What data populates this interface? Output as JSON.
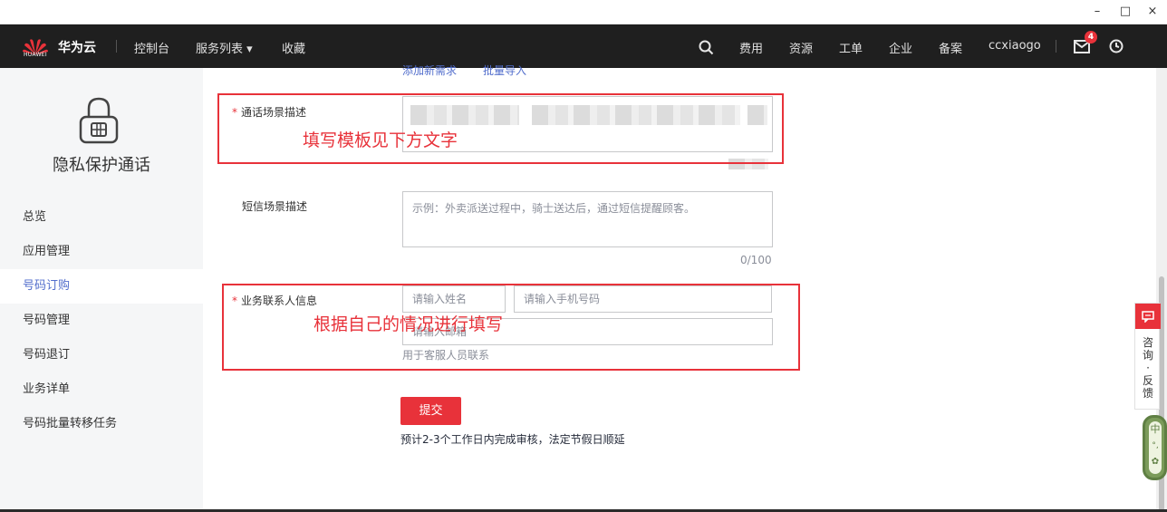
{
  "titlebar": {
    "minimize": "–",
    "maximize": "□",
    "close": "×"
  },
  "topnav": {
    "logo_text": "HUAWEI",
    "brand": "华为云",
    "console": "控制台",
    "services": "服务列表 ▾",
    "favorites": "收藏",
    "cost": "费用",
    "resources": "资源",
    "ticket": "工单",
    "enterprise": "企业",
    "filing": "备案",
    "username": "ccxiaogo",
    "message_count": "4"
  },
  "sidebar": {
    "title": "隐私保护通话",
    "items": [
      {
        "label": "总览"
      },
      {
        "label": "应用管理"
      },
      {
        "label": "号码订购",
        "active": true
      },
      {
        "label": "号码管理"
      },
      {
        "label": "号码退订"
      },
      {
        "label": "业务详单"
      },
      {
        "label": "号码批量转移任务"
      }
    ]
  },
  "form": {
    "add_new_link": "添加新需求",
    "batch_import_link": "批量导入",
    "call_scene": {
      "required": "*",
      "label": "通话场景描述"
    },
    "sms_scene": {
      "label": "短信场景描述",
      "placeholder": "示例：外卖派送过程中，骑士送达后，通过短信提醒顾客。",
      "counter": "0/100"
    },
    "contact": {
      "required": "*",
      "label": "业务联系人信息",
      "name_placeholder": "请输入姓名",
      "phone_placeholder": "请输入手机号码",
      "email_placeholder": "请输入邮箱",
      "hint": "用于客服人员联系"
    },
    "submit": "提交",
    "note": "预计2-3个工作日内完成审核，法定节假日顺延"
  },
  "annotations": {
    "call_scene_note": "填写模板见下方文字",
    "contact_note": "根据自己的情况进行填写"
  },
  "feedback": {
    "label_1": "咨",
    "label_2": "询",
    "label_3": "·",
    "label_4": "反",
    "label_5": "馈"
  },
  "ime": {
    "label": "中"
  },
  "colors": {
    "accent": "#e8323a",
    "link": "#526ecc",
    "topnav": "#1f1f1f"
  }
}
